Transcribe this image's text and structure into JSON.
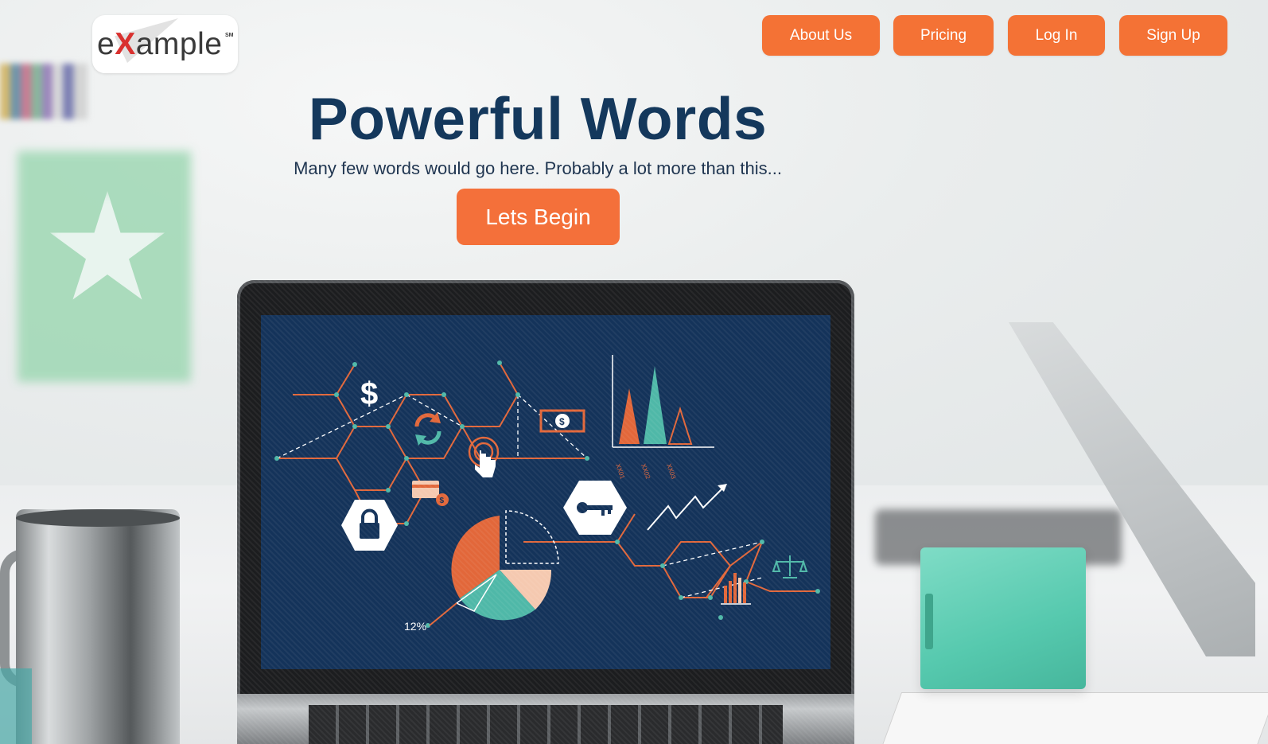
{
  "logo": {
    "prefix": "e",
    "accent": "X",
    "suffix": "ample",
    "mark": "SM"
  },
  "nav": {
    "about": "About Us",
    "pricing": "Pricing",
    "login": "Log In",
    "signup": "Sign Up"
  },
  "hero": {
    "title": "Powerful Words",
    "subtitle": "Many few words would go here. Probably a lot more than this...",
    "cta": "Lets Begin"
  },
  "screen_art": {
    "labels": {
      "x1": "XX01",
      "x2": "XX02",
      "x3": "XX03",
      "percent": "12%"
    },
    "icons": [
      "dollar-icon",
      "refresh-icon",
      "touch-icon",
      "money-bill-icon",
      "credit-card-icon",
      "lock-icon",
      "key-icon",
      "trend-arrow-icon",
      "bar-chart-icon",
      "scale-icon",
      "pie-chart-icon"
    ]
  },
  "colors": {
    "accent": "#f47235",
    "title": "#14385c",
    "screen": "#14335a",
    "teal": "#4fb8a8",
    "peach": "#f5c9b0"
  }
}
